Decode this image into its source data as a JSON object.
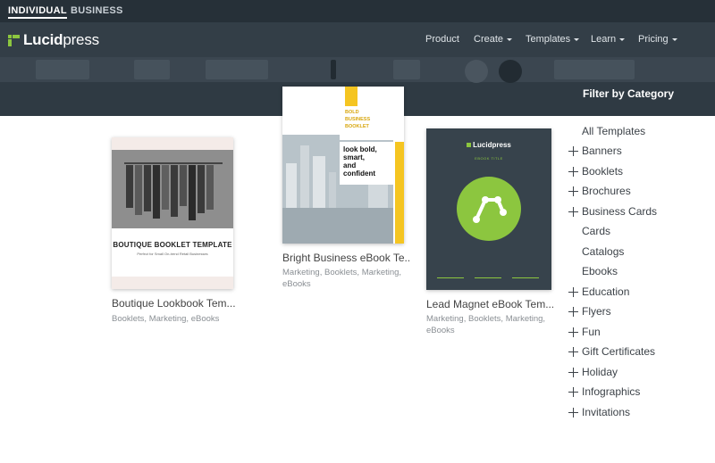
{
  "top_strip": {
    "segments": [
      "INDIVIDUAL",
      "BUSINESS"
    ],
    "active": "INDIVIDUAL"
  },
  "navbar": {
    "logo": {
      "text_a": "Lucid",
      "text_b": "press"
    },
    "links": [
      "Product",
      "Create",
      "Templates",
      "Learn",
      "Pricing"
    ]
  },
  "hero": {
    "filter_heading": "Filter by Category"
  },
  "templates": [
    {
      "title": "Boutique Lookbook Tem...",
      "tags": "Booklets, Marketing, eBooks",
      "thumb": {
        "heading": "BOUTIQUE BOOKLET TEMPLATE",
        "subheading": "Perfect for Small On-trend Retail Businesses"
      }
    },
    {
      "title": "Bright Business eBook Te...",
      "tags": "Marketing, Booklets, Marketing, eBooks",
      "thumb": {
        "label_lines": [
          "BOLD",
          "BUSINESS",
          "BOOKLET"
        ],
        "tagline_lines": [
          "look bold,",
          "smart,",
          "and",
          "confident"
        ]
      }
    },
    {
      "title": "Lead Magnet eBook Tem...",
      "tags": "Marketing, Booklets, Marketing, eBooks",
      "thumb": {
        "logo_text": "Lucidpress",
        "subtitle": "EBOOK TITLE"
      }
    }
  ],
  "categories": [
    {
      "label": "All Templates",
      "expandable": false
    },
    {
      "label": "Banners",
      "expandable": true
    },
    {
      "label": "Booklets",
      "expandable": true
    },
    {
      "label": "Brochures",
      "expandable": true
    },
    {
      "label": "Business Cards",
      "expandable": true
    },
    {
      "label": "Cards",
      "expandable": false
    },
    {
      "label": "Catalogs",
      "expandable": false
    },
    {
      "label": "Ebooks",
      "expandable": false
    },
    {
      "label": "Education",
      "expandable": true
    },
    {
      "label": "Flyers",
      "expandable": true
    },
    {
      "label": "Fun",
      "expandable": true
    },
    {
      "label": "Gift Certificates",
      "expandable": true
    },
    {
      "label": "Holiday",
      "expandable": true
    },
    {
      "label": "Infographics",
      "expandable": true
    },
    {
      "label": "Invitations",
      "expandable": true
    }
  ],
  "colors": {
    "top_strip_bg": "#263038",
    "navbar_bg": "#333e47",
    "brand_green": "#8cc63f",
    "accent_yellow": "#f5c521"
  }
}
